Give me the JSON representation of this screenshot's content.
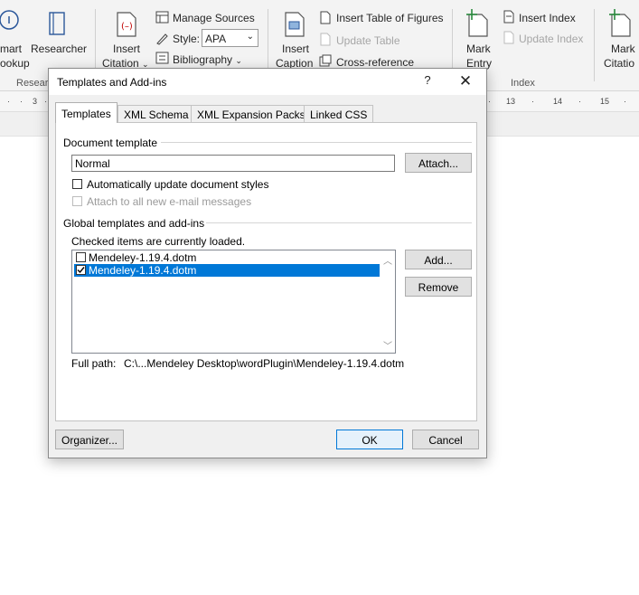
{
  "ribbon": {
    "smart_lookup_1": "mart",
    "smart_lookup_2": "ookup",
    "researcher": "Researcher",
    "research_group": "Resear",
    "insert_citation_1": "Insert",
    "insert_citation_2": "Citation",
    "manage_sources": "Manage Sources",
    "style_label": "Style:",
    "style_value": "APA",
    "bibliography": "Bibliography",
    "insert_caption_1": "Insert",
    "insert_caption_2": "Caption",
    "insert_table_of_figures": "Insert Table of Figures",
    "update_table": "Update Table",
    "cross_reference": "Cross-reference",
    "mark_entry_1": "Mark",
    "mark_entry_2": "Entry",
    "insert_index": "Insert Index",
    "update_index": "Update Index",
    "index_group": "Index",
    "mark_citation_1": "Mark",
    "mark_citation_2": "Citatio"
  },
  "ruler": {
    "marks": [
      "3",
      "13",
      "14",
      "15"
    ]
  },
  "dialog": {
    "title": "Templates and Add-ins",
    "help": "?",
    "close": "✕",
    "tabs": [
      "Templates",
      "XML Schema",
      "XML Expansion Packs",
      "Linked CSS"
    ],
    "document_template_label": "Document template",
    "document_template_value": "Normal",
    "attach_button": "Attach...",
    "auto_update_label": "Automatically update document styles",
    "attach_email_label": "Attach to all new e-mail messages",
    "global_templates_label": "Global templates and add-ins",
    "checked_items_label": "Checked items are currently loaded.",
    "list_items": [
      {
        "name": "Mendeley-1.19.4.dotm",
        "checked": false,
        "selected": false
      },
      {
        "name": "Mendeley-1.19.4.dotm",
        "checked": true,
        "selected": true
      }
    ],
    "add_button": "Add...",
    "remove_button": "Remove",
    "full_path_label": "Full path:",
    "full_path_value": "C:\\...Mendeley Desktop\\wordPlugin\\Mendeley-1.19.4.dotm",
    "organizer_button": "Organizer...",
    "ok_button": "OK",
    "cancel_button": "Cancel"
  }
}
